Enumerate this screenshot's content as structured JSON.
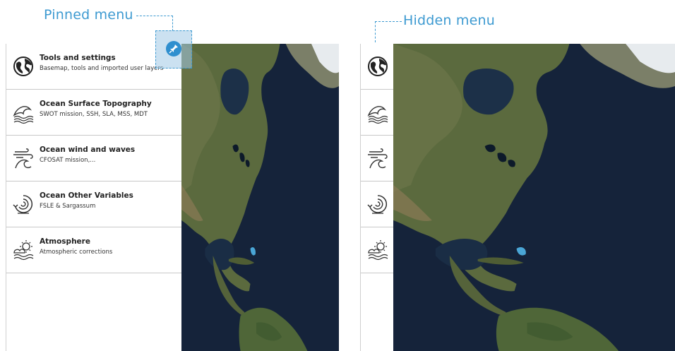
{
  "captions": {
    "pinned": "Pinned menu",
    "hidden": "Hidden menu"
  },
  "menu_items": [
    {
      "icon": "globe-icon",
      "title": "Tools and settings",
      "subtitle": "Basemap, tools and imported user layers"
    },
    {
      "icon": "ocean-surface-icon",
      "title": "Ocean Surface Topography",
      "subtitle": "SWOT mission, SSH, SLA, MSS, MDT"
    },
    {
      "icon": "wind-waves-icon",
      "title": "Ocean wind and waves",
      "subtitle": "CFOSAT mission,..."
    },
    {
      "icon": "ocean-variables-icon",
      "title": "Ocean Other Variables",
      "subtitle": "FSLE & Sargassum"
    },
    {
      "icon": "atmosphere-icon",
      "title": "Atmosphere",
      "subtitle": "Atmospheric corrections"
    }
  ],
  "colors": {
    "accent": "#3d9ad1",
    "pin_button": "#2f8fcf",
    "ocean": "#16243a",
    "land": "#5b6a3e"
  }
}
